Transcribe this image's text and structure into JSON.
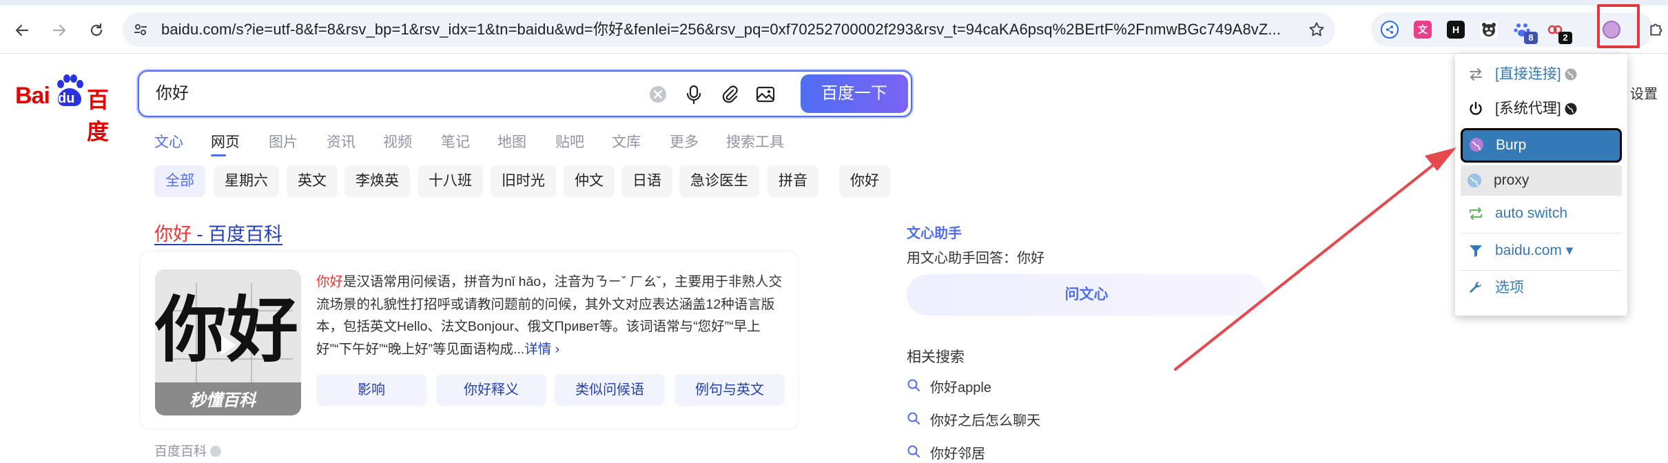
{
  "browser": {
    "url": "baidu.com/s?ie=utf-8&f=8&rsv_bp=1&rsv_idx=1&tn=baidu&wd=你好&fenlei=256&rsv_pq=0xf70252700002f293&rsv_t=94caKA6psq%2BErtF%2FnmwBGc749A8vZ...",
    "extensions": [
      {
        "name": "share-extension",
        "badge": ""
      },
      {
        "name": "translate-extension",
        "badge": ""
      },
      {
        "name": "h-extension",
        "badge": ""
      },
      {
        "name": "bear-extension",
        "badge": ""
      },
      {
        "name": "paw-extension",
        "badge": "8"
      },
      {
        "name": "link-extension",
        "badge": "2"
      },
      {
        "name": "proxy-extension",
        "badge": ""
      }
    ]
  },
  "baidu": {
    "logo_left": "Bai",
    "logo_du": "du",
    "logo_right": "百度",
    "query": "你好",
    "search_button": "百度一下",
    "tabs": [
      "文心",
      "网页",
      "图片",
      "资讯",
      "视频",
      "笔记",
      "地图",
      "贴吧",
      "文库",
      "更多",
      "搜索工具"
    ],
    "chips": [
      "全部",
      "星期六",
      "英文",
      "李焕英",
      "十八班",
      "旧时光",
      "仲文",
      "日语",
      "急诊医生",
      "拼音",
      "你好"
    ],
    "settings": "设置"
  },
  "result": {
    "title_kw": "你好",
    "title_rest": " - 百度百科",
    "desc_kw": "你好",
    "desc": "是汉语常用问候语，拼音为nǐ hǎo，注音为ㄋㄧˇ ㄏㄠˇ，主要用于非熟人交流场景的礼貌性打招呼或请教问题前的问候，其外文对应表达涵盖12种语言版本，包括英文Hello、法文Bonjour、俄文Привет等。该词语常与“您好”“早上好”“下午好”“晚上好”等见面语构成...",
    "more": "详情 ›",
    "pills": [
      "影响",
      "你好释义",
      "类似问候语",
      "例句与英文"
    ],
    "thumb_char1": "你",
    "thumb_char2": "好",
    "thumb_logo": "秒懂百科",
    "source": "百度百科"
  },
  "assistant": {
    "title": "文心助手",
    "text": "用文心助手回答：你好",
    "button": "问文心"
  },
  "related": {
    "title": "相关搜索",
    "items": [
      "你好apple",
      "你好之后怎么聊天",
      "你好邻居"
    ]
  },
  "proxy_menu": {
    "items": [
      {
        "label": "[直接连接]",
        "color": "#337ab7"
      },
      {
        "label": "[系统代理]",
        "color": "#222222"
      },
      {
        "label": "Burp",
        "color": "#ffffff"
      },
      {
        "label": "proxy",
        "color": "#333333"
      },
      {
        "label": "auto switch",
        "color": "#337ab7"
      },
      {
        "label": "baidu.com ▾",
        "color": "#337ab7"
      },
      {
        "label": "选项",
        "color": "#337ab7"
      }
    ]
  },
  "colors": {
    "baidu_blue": "#4e6ef2",
    "baidu_red": "#e10601",
    "selected_bg": "#337ab7",
    "highlight_red": "#e0393e"
  }
}
